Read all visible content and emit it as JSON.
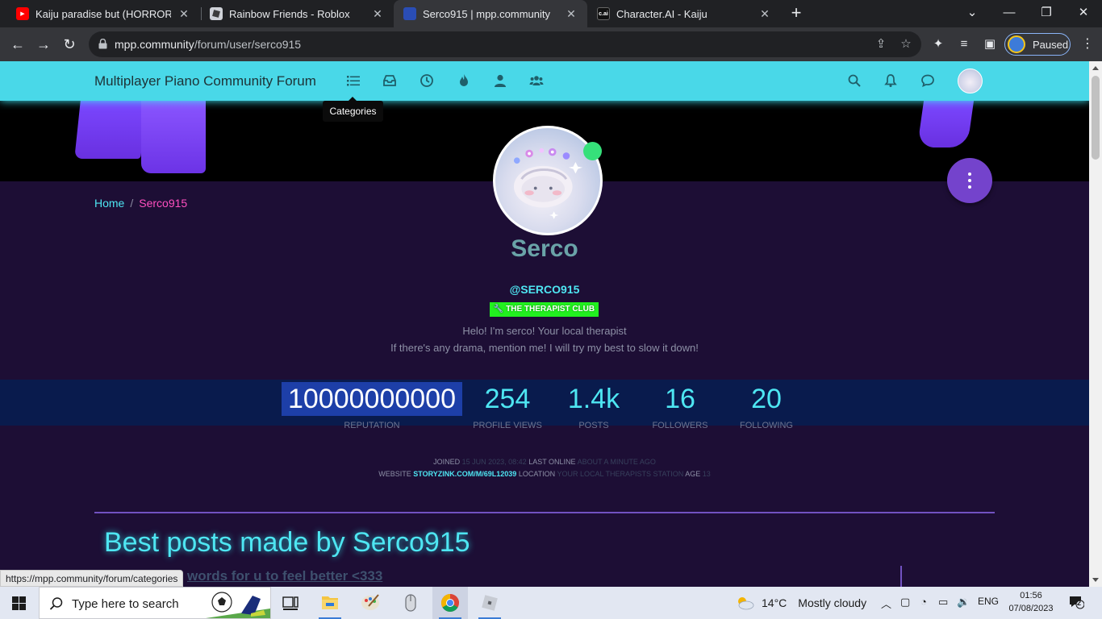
{
  "browser": {
    "tabs": [
      {
        "title": "Kaiju paradise but (HORROR) gan",
        "favicon": "youtube-icon",
        "active": false
      },
      {
        "title": "Rainbow Friends - Roblox",
        "favicon": "roblox-icon",
        "active": false
      },
      {
        "title": "Serco915 | mpp.community",
        "favicon": "mpp-icon",
        "active": true
      },
      {
        "title": "Character.AI - Kaiju",
        "favicon": "characterai-icon",
        "active": false
      }
    ],
    "url_host": "mpp.community",
    "url_path": "/forum/user/serco915",
    "profile_label": "Paused",
    "status_url": "https://mpp.community/forum/categories"
  },
  "site": {
    "brand": "Multiplayer Piano Community Forum",
    "nav_icons": [
      "list-icon",
      "inbox-icon",
      "clock-icon",
      "fire-icon",
      "user-icon",
      "users-icon"
    ],
    "right_icons": [
      "search-icon",
      "bell-icon",
      "chat-icon"
    ],
    "tooltip": "Categories",
    "breadcrumb": {
      "home": "Home",
      "separator": "/",
      "current": "Serco915"
    }
  },
  "profile": {
    "display_name": "Serco",
    "username": "@SERCO915",
    "group_badge": "THE THERAPIST CLUB",
    "about_line1": "Helo! I'm serco! Your local therapist",
    "about_line2": "If there's any drama, mention me! I will try my best to slow it down!",
    "stats": [
      {
        "value": "10000000000",
        "label": "REPUTATION",
        "selected": true
      },
      {
        "value": "254",
        "label": "PROFILE VIEWS",
        "selected": false
      },
      {
        "value": "1.4k",
        "label": "POSTS",
        "selected": false
      },
      {
        "value": "16",
        "label": "FOLLOWERS",
        "selected": false
      },
      {
        "value": "20",
        "label": "FOLLOWING",
        "selected": false
      }
    ],
    "meta": {
      "joined_label": "JOINED",
      "joined_value": "15 JUN 2023, 08:42",
      "last_online_label": "LAST ONLINE",
      "last_online_value": "ABOUT A MINUTE AGO",
      "website_label": "WEBSITE",
      "website_value": "STORYZINK.COM/M/69L12039",
      "location_label": "LOCATION",
      "location_value": "YOUR LOCAL THERAPISTS STATION",
      "age_label": "AGE",
      "age_value": "13"
    },
    "best_posts_heading": "Best posts made by Serco915",
    "first_post_fragment": "words for u to feel better <333"
  },
  "taskbar": {
    "search_placeholder": "Type here to search",
    "weather_temp": "14°C",
    "weather_desc": "Mostly cloudy",
    "language": "ENG",
    "time": "01:56",
    "date": "07/08/2023",
    "notification_count": "2"
  },
  "colors": {
    "nav_bg": "#49d8e8",
    "page_bg": "#1d0e35",
    "accent_cyan": "#4ee6f2",
    "accent_pink": "#ff4fc0",
    "badge_green": "#22f01f",
    "fab_purple": "#7443cc"
  }
}
